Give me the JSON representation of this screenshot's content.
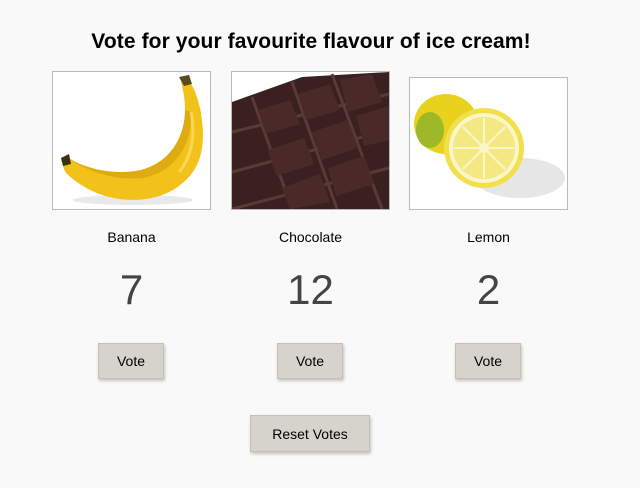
{
  "page": {
    "title": "Vote for your favourite flavour of ice cream!"
  },
  "flavours": [
    {
      "name": "Banana",
      "votes": "7",
      "vote_label": "Vote",
      "image": "banana-image"
    },
    {
      "name": "Chocolate",
      "votes": "12",
      "vote_label": "Vote",
      "image": "chocolate-image"
    },
    {
      "name": "Lemon",
      "votes": "2",
      "vote_label": "Vote",
      "image": "lemon-image"
    }
  ],
  "reset": {
    "label": "Reset Votes"
  },
  "colors": {
    "background": "#f9f9f9",
    "button_face": "#d6d3cc",
    "count_text": "#444444"
  }
}
